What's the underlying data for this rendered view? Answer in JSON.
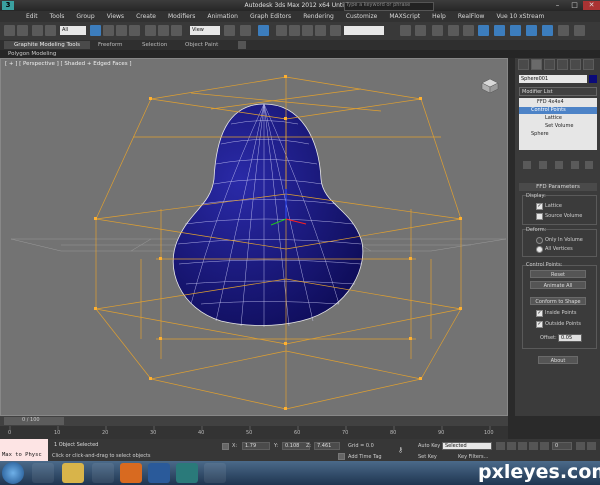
{
  "window": {
    "title": "Autodesk 3ds Max  2012 x64      Untitled",
    "search_placeholder": "Type a keyword or phrase"
  },
  "menubar": {
    "items": [
      "Edit",
      "Tools",
      "Group",
      "Views",
      "Create",
      "Modifiers",
      "Animation",
      "Graph Editors",
      "Rendering",
      "Customize",
      "MAXScript",
      "Help",
      "RealFlow",
      "Vue 10 xStream"
    ]
  },
  "toolbar": {
    "selection_filter": "All",
    "reference_coord": "View"
  },
  "ribbon": {
    "tabs": [
      "Graphite Modeling Tools",
      "Freeform",
      "Selection",
      "Object Paint"
    ],
    "sub_label": "Polygon Modeling"
  },
  "viewport": {
    "label": "[ + ] [ Perspective ] [ Shaded + Edged Faces ]"
  },
  "command_panel": {
    "object_name": "Sphere001",
    "modifier_list": "Modifier List",
    "stack": [
      "FFD 4x4x4",
      "Control Points",
      "Lattice",
      "Set Volume",
      "Sphere"
    ],
    "rollout_title": "FFD Parameters",
    "display": {
      "label": "Display:",
      "lattice": "Lattice",
      "source_volume": "Source Volume"
    },
    "deform": {
      "label": "Deform:",
      "only_in_volume": "Only In Volume",
      "all_vertices": "All Vertices"
    },
    "control_points": {
      "label": "Control Points:",
      "reset": "Reset",
      "animate_all": "Animate All",
      "conform": "Conform to Shape",
      "inside_points": "Inside Points",
      "outside_points": "Outside Points",
      "offset_label": "Offset:",
      "offset_value": "0.05"
    },
    "about": "About"
  },
  "timeline": {
    "frame": "0 / 100",
    "ticks": [
      "0",
      "10",
      "20",
      "30",
      "40",
      "50",
      "60",
      "70",
      "80",
      "90",
      "100"
    ]
  },
  "status": {
    "maxscript": "Max to Physc",
    "selected": "1 Object Selected",
    "prompt": "Click or click-and-drag to select objects",
    "x": "1.79",
    "y": "0.108",
    "z": "7.461",
    "grid": "Grid = 0.0",
    "add_time_tag": "Add Time Tag",
    "auto_key": "Auto Key",
    "set_key": "Set Key",
    "key_filters": "Key Filters...",
    "key_mode": "Selected",
    "frame_field": "0"
  },
  "watermark": "pxleyes.com",
  "colors": {
    "sphere": "#1d1a86",
    "lattice": "#e0a030",
    "selection": "#4d83c7"
  }
}
